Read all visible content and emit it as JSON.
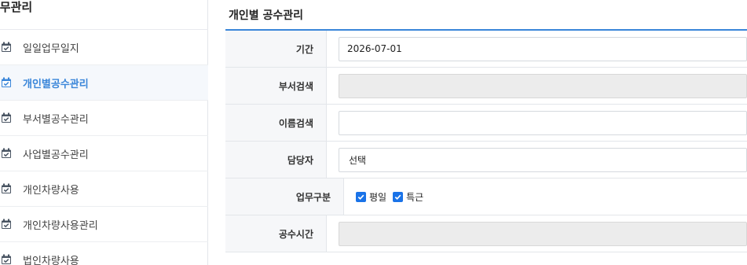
{
  "sidebar": {
    "title": "업무관리",
    "items": [
      {
        "label": "일일업무일지",
        "active": false
      },
      {
        "label": "개인별공수관리",
        "active": true
      },
      {
        "label": "부서별공수관리",
        "active": false
      },
      {
        "label": "사업별공수관리",
        "active": false
      },
      {
        "label": "개인차량사용",
        "active": false
      },
      {
        "label": "개인차량사용관리",
        "active": false
      },
      {
        "label": "법인차량사용",
        "active": false
      }
    ],
    "icon": "calendar-check-icon",
    "icon_color": "#4a5563",
    "active_color": "#3a86d9"
  },
  "main": {
    "title": "개인별 공수관리",
    "accent": "#3a86d9",
    "form": {
      "period_label": "기간",
      "period_value": "2026-07-01",
      "dept_label": "부서검색",
      "dept_value": "",
      "name_label": "이름검색",
      "name_value": "",
      "manager_label": "담당자",
      "manager_value": "선택",
      "worktype_label": "업무구분",
      "worktype_options": [
        {
          "label": "평일",
          "checked": true
        },
        {
          "label": "특근",
          "checked": true
        }
      ],
      "hours_label": "공수시간",
      "hours_value": ""
    }
  }
}
